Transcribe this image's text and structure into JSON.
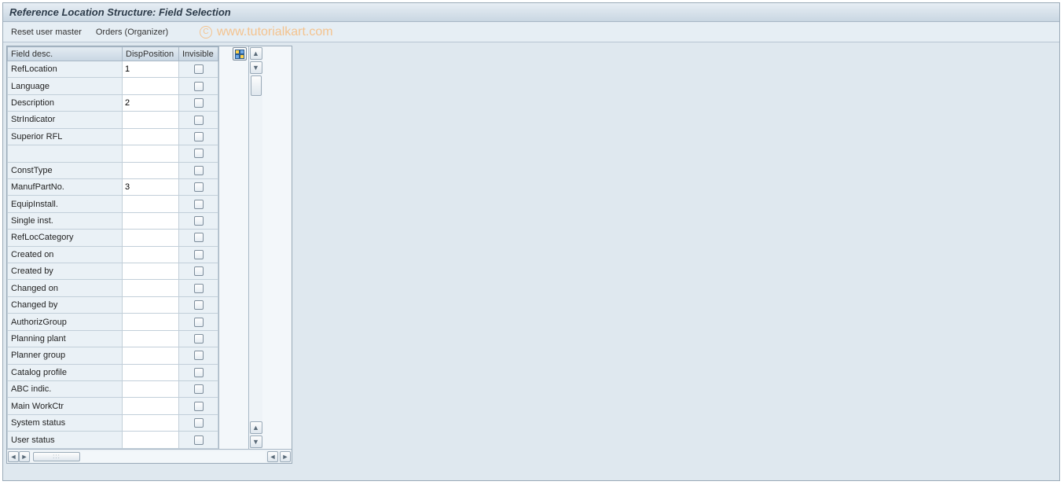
{
  "title": "Reference Location Structure: Field Selection",
  "toolbar": {
    "reset_label": "Reset user master",
    "orders_label": "Orders (Organizer)"
  },
  "watermark": "www.tutorialkart.com",
  "table": {
    "headers": {
      "field_desc": "Field desc.",
      "disp_position": "DispPosition",
      "invisible": "Invisible"
    },
    "rows": [
      {
        "label": "RefLocation",
        "pos": "1",
        "inv": false
      },
      {
        "label": "Language",
        "pos": "",
        "inv": false
      },
      {
        "label": "Description",
        "pos": "2",
        "inv": false
      },
      {
        "label": "StrIndicator",
        "pos": "",
        "inv": false
      },
      {
        "label": "Superior RFL",
        "pos": "",
        "inv": false
      },
      {
        "label": "",
        "pos": "",
        "inv": false
      },
      {
        "label": "ConstType",
        "pos": "",
        "inv": false
      },
      {
        "label": "ManufPartNo.",
        "pos": "3",
        "inv": false
      },
      {
        "label": "EquipInstall.",
        "pos": "",
        "inv": false
      },
      {
        "label": "Single inst.",
        "pos": "",
        "inv": false
      },
      {
        "label": "RefLocCategory",
        "pos": "",
        "inv": false
      },
      {
        "label": "Created on",
        "pos": "",
        "inv": false
      },
      {
        "label": "Created by",
        "pos": "",
        "inv": false
      },
      {
        "label": "Changed on",
        "pos": "",
        "inv": false
      },
      {
        "label": "Changed by",
        "pos": "",
        "inv": false
      },
      {
        "label": "AuthorizGroup",
        "pos": "",
        "inv": false
      },
      {
        "label": "Planning plant",
        "pos": "",
        "inv": false
      },
      {
        "label": "Planner group",
        "pos": "",
        "inv": false
      },
      {
        "label": "Catalog profile",
        "pos": "",
        "inv": false
      },
      {
        "label": "ABC indic.",
        "pos": "",
        "inv": false
      },
      {
        "label": "Main WorkCtr",
        "pos": "",
        "inv": false
      },
      {
        "label": "System status",
        "pos": "",
        "inv": false
      },
      {
        "label": "User status",
        "pos": "",
        "inv": false
      }
    ]
  }
}
